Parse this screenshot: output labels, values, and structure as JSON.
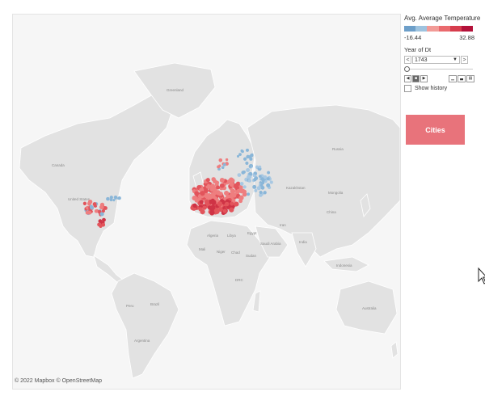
{
  "map": {
    "attribution": "© 2022 Mapbox © OpenStreetMap",
    "labels": {
      "canada": "Canada",
      "united_states": "United States",
      "greenland": "Greenland",
      "russia": "Russia",
      "kazakhstan": "Kazakhstan",
      "china": "China",
      "iran": "Iran",
      "algeria": "Algeria",
      "libya": "Libya",
      "egypt": "Egypt",
      "mali": "Mali",
      "niger": "Niger",
      "chad": "Chad",
      "sudan": "Sudan",
      "drc": "DRC",
      "brazil": "Brazil",
      "peru": "Peru",
      "argentina": "Argentina",
      "australia": "Australia",
      "india": "India",
      "mongolia": "Mongolia",
      "indonesia": "Indonesia",
      "saudi_arabia": "Saudi Arabia"
    }
  },
  "legend": {
    "title": "Avg. Average Temperature",
    "min": "-16.44",
    "max": "32.88",
    "colors": [
      "#6d9fc9",
      "#9ec3df",
      "#f29b97",
      "#ea6a6e",
      "#d63d4d",
      "#b3113a"
    ]
  },
  "filter": {
    "title": "Year of Dt",
    "value": "1743",
    "prev": "<",
    "next": ">",
    "slider_position": 0,
    "show_history_label": "Show history",
    "show_history_checked": false
  },
  "controls": {
    "back": "◀",
    "stop": "■",
    "play": "▶"
  },
  "button": {
    "label": "Cities"
  },
  "dot_colors": {
    "cold": "#8ab6d8",
    "cool": "#a8c8e2",
    "warm": "#ee7e7f",
    "hot": "#e2545b",
    "hotter": "#cf3345"
  }
}
